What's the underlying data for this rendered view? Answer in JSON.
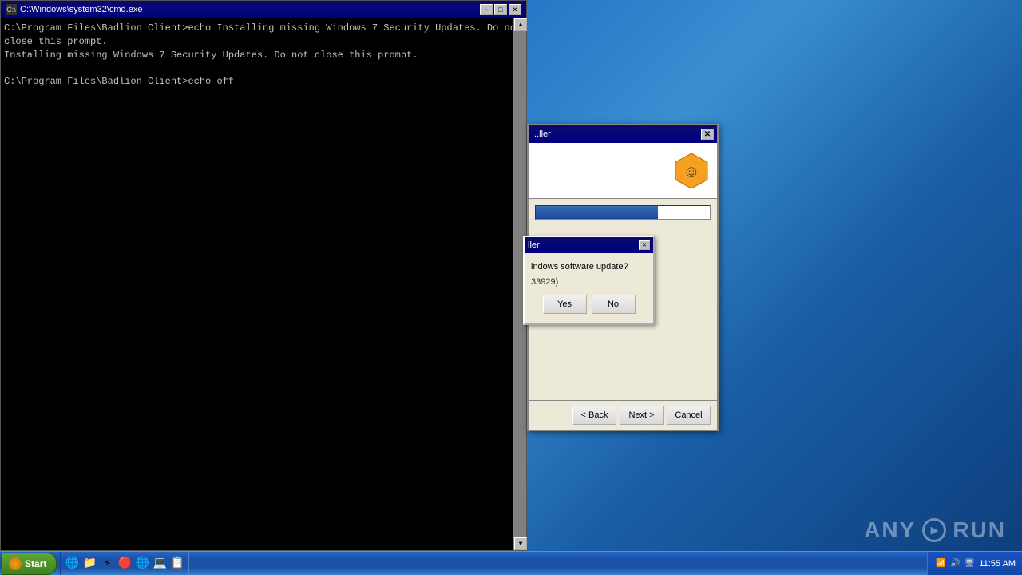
{
  "desktop": {
    "background": "Windows 7 desktop"
  },
  "cmd_window": {
    "title": "C:\\Windows\\system32\\cmd.exe",
    "lines": [
      "C:\\Program Files\\Badlion Client>echo Installing missing Windows 7 Security Updates. Do not close this prompt.",
      "Installing missing Windows 7 Security Updates. Do not close this prompt.",
      "",
      "C:\\Program Files\\Badlion Client>echo off"
    ],
    "titlebar_minimize": "−",
    "titlebar_restore": "□",
    "titlebar_close": "✕"
  },
  "installer_window": {
    "title": "...ller",
    "close_btn": "✕",
    "logo_char": "☺"
  },
  "dialog": {
    "title": "ller",
    "close_btn": "✕",
    "question": "indows software update?",
    "detail": "33929)",
    "yes_label": "Yes",
    "no_label": "No"
  },
  "installer_buttons": {
    "back": "< Back",
    "next": "Next >",
    "cancel": "Cancel"
  },
  "taskbar": {
    "start_label": "Start",
    "time": "11:55 AM"
  },
  "anyrun": {
    "text": "ANY",
    "text2": "RUN"
  },
  "quick_launch_icons": [
    "🌐",
    "📁",
    "⚡",
    "🔴",
    "🌐",
    "💻",
    "📋"
  ],
  "tray_icons": [
    "🔊",
    "📶",
    "🖥"
  ]
}
